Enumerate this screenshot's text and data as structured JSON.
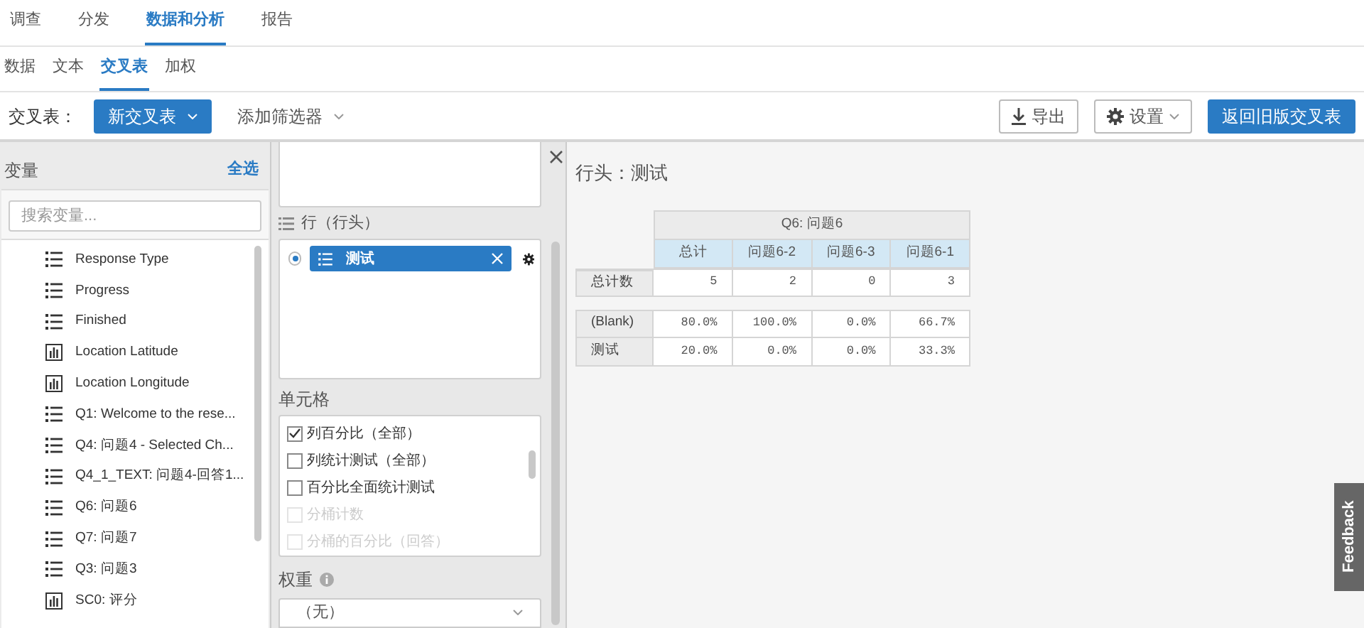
{
  "nav_tabs": [
    {
      "label": "调查",
      "selected": false
    },
    {
      "label": "分发",
      "selected": false
    },
    {
      "label": "数据和分析",
      "selected": true
    },
    {
      "label": "报告",
      "selected": false
    }
  ],
  "sub_tabs": [
    {
      "label": "数据",
      "selected": false
    },
    {
      "label": "文本",
      "selected": false
    },
    {
      "label": "交叉表",
      "selected": true
    },
    {
      "label": "加权",
      "selected": false
    }
  ],
  "toolbar": {
    "label": "交叉表：",
    "new_button": "新交叉表",
    "filter_button": "添加筛选器",
    "export_button": "导出",
    "settings_button": "设置",
    "legacy_button": "返回旧版交叉表"
  },
  "variables": {
    "title": "变量",
    "select_all": "全选",
    "search": {
      "placeholder": "搜索变量..."
    },
    "items": [
      {
        "label": "Response Type",
        "kind": "list"
      },
      {
        "label": "Progress",
        "kind": "list"
      },
      {
        "label": "Finished",
        "kind": "list"
      },
      {
        "label": "Location Latitude",
        "kind": "chart"
      },
      {
        "label": "Location Longitude",
        "kind": "chart"
      },
      {
        "label": "Q1: Welcome to the rese...",
        "kind": "list"
      },
      {
        "label": "Q4: 问题4 - Selected Ch...",
        "kind": "list"
      },
      {
        "label": "Q4_1_TEXT: 问题4-回答1...",
        "kind": "list"
      },
      {
        "label": "Q6: 问题6",
        "kind": "list"
      },
      {
        "label": "Q7: 问题7",
        "kind": "list"
      },
      {
        "label": "Q3: 问题3",
        "kind": "list"
      },
      {
        "label": "SC0: 评分",
        "kind": "chart"
      }
    ]
  },
  "rows_section": {
    "title": "行（行头）",
    "chips": [
      {
        "label": "测试",
        "selected": true
      }
    ]
  },
  "cells_section": {
    "title": "单元格",
    "options": [
      {
        "label": "列百分比（全部）",
        "checked": true,
        "disabled": false
      },
      {
        "label": "列统计测试（全部）",
        "checked": false,
        "disabled": false
      },
      {
        "label": "百分比全面统计测试",
        "checked": false,
        "disabled": false
      },
      {
        "label": "分桶计数",
        "checked": false,
        "disabled": true
      },
      {
        "label": "分桶的百分比（回答）",
        "checked": false,
        "disabled": true
      }
    ]
  },
  "weight": {
    "title": "权重",
    "value": "（无）"
  },
  "results": {
    "title": "行头：测试",
    "group_header": "Q6: 问题6",
    "columns": [
      "总计",
      "问题6-2",
      "问题6-3",
      "问题6-1"
    ],
    "total_row": {
      "label": "总计数",
      "cells": [
        "5",
        "2",
        "0",
        "3"
      ]
    },
    "rows": [
      {
        "label": "(Blank)",
        "cells": [
          "80.0%",
          "100.0%",
          "0.0%",
          "66.7%"
        ]
      },
      {
        "label": "测试",
        "cells": [
          "20.0%",
          "0.0%",
          "0.0%",
          "33.3%"
        ]
      }
    ]
  },
  "feedback": "Feedback"
}
